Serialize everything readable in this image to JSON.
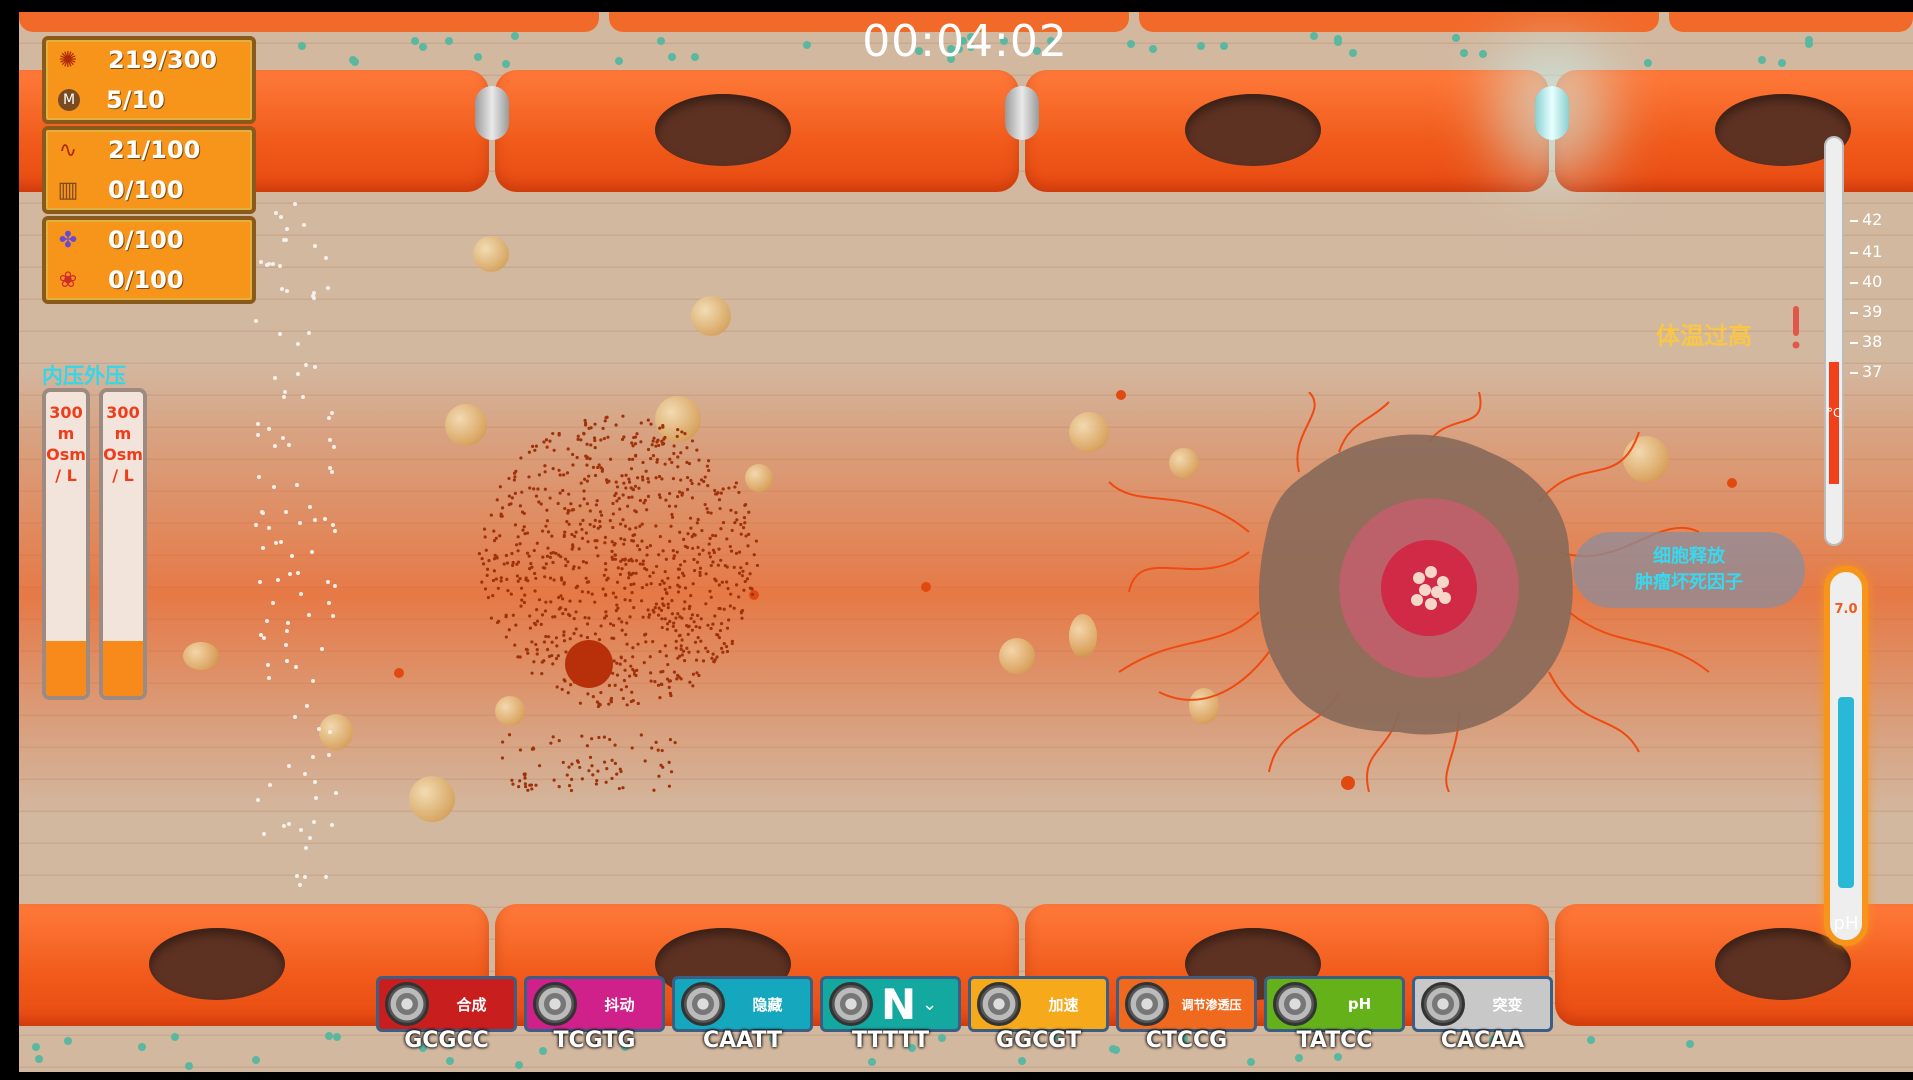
{
  "timer": "00:04:02",
  "resources": [
    {
      "top": {
        "icon": "virus-icon",
        "value": "219/300"
      },
      "bottom": {
        "icon": "m-coin-icon",
        "value": "5/10"
      }
    },
    {
      "top": {
        "icon": "chain-icon",
        "value": "21/100"
      },
      "bottom": {
        "icon": "crate-icon",
        "value": "0/100"
      }
    },
    {
      "top": {
        "icon": "cluster-icon",
        "value": "0/100"
      },
      "bottom": {
        "icon": "flower-icon",
        "value": "0/100"
      }
    }
  ],
  "pressure": {
    "inner_label": "内压",
    "outer_label": "外压",
    "inner_text": "300 m Osm / L",
    "outer_text": "300 m Osm / L",
    "inner_level": 0.18,
    "outer_level": 0.18
  },
  "thermometer": {
    "ticks": [
      "42",
      "41",
      "40",
      "39",
      "38",
      "37"
    ],
    "unit": "°C",
    "warning": "体温过高",
    "fill_level": 0.3
  },
  "ph": {
    "value": "7.0",
    "label": "pH",
    "fill_level": 0.52
  },
  "tooltip": {
    "line1": "细胞释放",
    "line2": "肿瘤坏死因子"
  },
  "toolbar": [
    {
      "label": "合成",
      "code": "GCGCC",
      "color": "#c81e1e"
    },
    {
      "label": "抖动",
      "code": "TCGTG",
      "color": "#d0208a"
    },
    {
      "label": "隐藏",
      "code": "CAATT",
      "color": "#15a7be"
    },
    {
      "label": "N",
      "code": "TTTTT",
      "color": "#13a9a0"
    },
    {
      "label": "加速",
      "code": "GGCGT",
      "color": "#f5a91b"
    },
    {
      "label": "调节渗透压",
      "code": "CTCCG",
      "color": "#ef6a1e"
    },
    {
      "label": "pH",
      "code": "TATCC",
      "color": "#64b11a"
    },
    {
      "label": "突变",
      "code": "CACAA",
      "color": "#c8c8c8"
    }
  ],
  "colors": {
    "vessel": "#f05a1a",
    "panel": "#f7951b",
    "accent_cyan": "#36d6e8"
  }
}
